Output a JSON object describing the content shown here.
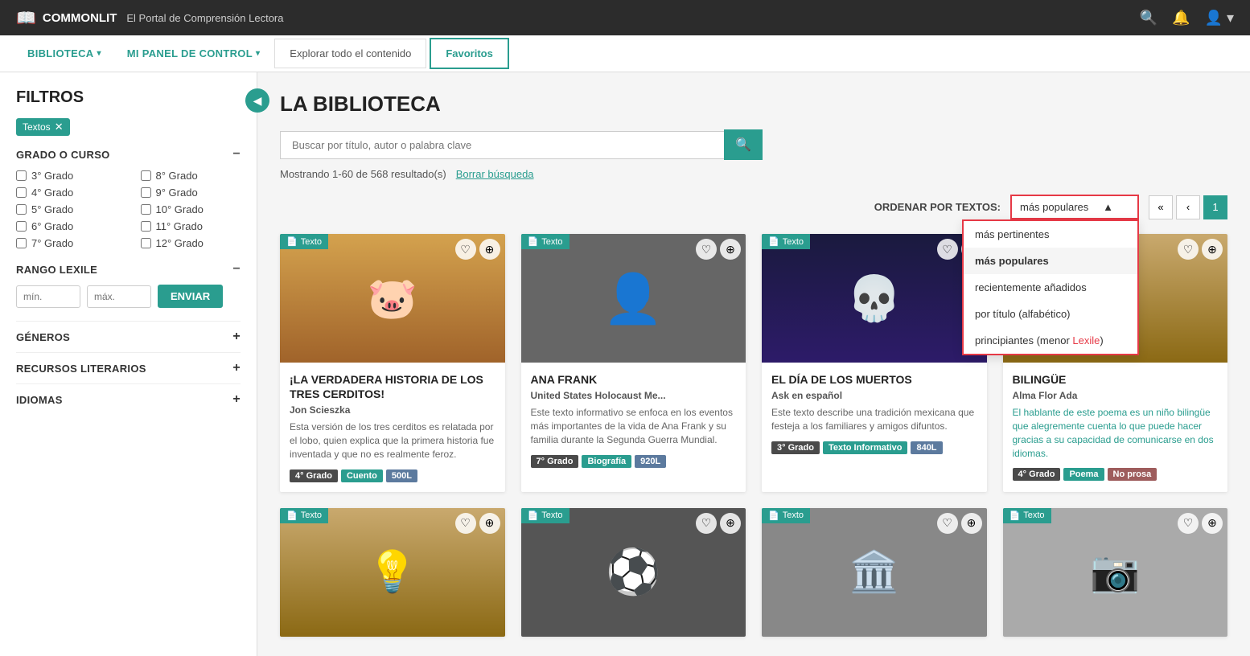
{
  "brand": {
    "name": "COMMONLIT",
    "tagline": "El Portal de Comprensión Lectora"
  },
  "topnav": {
    "icons": [
      "search",
      "bell",
      "user"
    ]
  },
  "secondarynav": {
    "items": [
      {
        "id": "biblioteca",
        "label": "BIBLIOTECA",
        "hasCaret": true
      },
      {
        "id": "mi-panel",
        "label": "MI PANEL DE CONTROL",
        "hasCaret": true
      }
    ],
    "tabs": [
      {
        "id": "explorar",
        "label": "Explorar todo el contenido",
        "active": false
      },
      {
        "id": "favoritos",
        "label": "Favoritos",
        "active": true
      }
    ]
  },
  "sidebar": {
    "title": "FILTROS",
    "activeFilter": "Textos",
    "sections": {
      "gradeTitle": "GRADO O CURSO",
      "gradesLeft": [
        "3° Grado",
        "4° Grado",
        "5° Grado",
        "6° Grado",
        "7° Grado"
      ],
      "gradesRight": [
        "8° Grado",
        "9° Grado",
        "10° Grado",
        "11° Grado",
        "12° Grado"
      ],
      "lexileTitle": "RANGO LEXILE",
      "lexileMin": "mín.",
      "lexileMax": "máx.",
      "enviarLabel": "ENVIAR",
      "genresTitle": "GÉNEROS",
      "literaryTitle": "RECURSOS LITERARIOS",
      "idiomasTitle": "IDIOMAS"
    }
  },
  "main": {
    "pageTitle": "LA BIBLIOTECA",
    "searchPlaceholder": "Buscar por título, autor o palabra clave",
    "resultsText": "Mostrando 1-60 de 568 resultado(s)",
    "clearText": "Borrar búsqueda",
    "sortLabel": "ORDENAR POR TEXTOS:",
    "sortSelected": "más populares",
    "sortOptions": [
      {
        "id": "relevantes",
        "label": "más pertinentes"
      },
      {
        "id": "populares",
        "label": "más populares",
        "selected": true
      },
      {
        "id": "recientes",
        "label": "recientemente añadidos"
      },
      {
        "id": "titulo",
        "label": "por título (alfabético)"
      },
      {
        "id": "principiantes",
        "label": "principiantes (menor Lexile)",
        "highlightWord": "Lexile"
      }
    ],
    "pagination": {
      "prev2": "«",
      "prev": "‹",
      "current": "1"
    },
    "cards": [
      {
        "id": "tres-cerditos",
        "labelIcon": "📄",
        "labelText": "Texto",
        "bgColor": "#8B6914",
        "emoji": "🐷",
        "title": "¡LA VERDADERA HISTORIA DE LOS TRES CERDITOS!",
        "author": "Jon Scieszka",
        "desc": "Esta versión de los tres cerditos es relatada por el lobo, quien explica que la primera historia fue inventada y que no es realmente feroz.",
        "tags": [
          {
            "label": "4° Grado",
            "type": "grade"
          },
          {
            "label": "Cuento",
            "type": "genre"
          },
          {
            "label": "500L",
            "type": "lexile"
          }
        ]
      },
      {
        "id": "ana-frank",
        "labelIcon": "📄",
        "labelText": "Texto",
        "bgColor": "#555",
        "emoji": "📖",
        "title": "ANA FRANK",
        "author": "United States Holocaust Me...",
        "desc": "Este texto informativo se enfoca en los eventos más importantes de la vida de Ana Frank y su familia durante la Segunda Guerra Mundial.",
        "tags": [
          {
            "label": "7° Grado",
            "type": "grade"
          },
          {
            "label": "Biografía",
            "type": "genre"
          },
          {
            "label": "920L",
            "type": "lexile"
          }
        ]
      },
      {
        "id": "dia-muertos",
        "labelIcon": "📄",
        "labelText": "Texto",
        "bgColor": "#1a1a3e",
        "emoji": "💀",
        "title": "EL DÍA DE LOS MUERTOS",
        "author": "Ask en español",
        "desc": "Este texto describe una tradición mexicana que festeja a los familiares y amigos difuntos.",
        "tags": [
          {
            "label": "3° Grado",
            "type": "grade"
          },
          {
            "label": "Texto Informativo",
            "type": "genre"
          },
          {
            "label": "840L",
            "type": "lexile"
          }
        ]
      },
      {
        "id": "bilingue",
        "labelIcon": "📄",
        "labelText": "Texto",
        "bgColor": "#b8860b",
        "emoji": "📚",
        "title": "BILINGÜE",
        "author": "Alma Flor Ada",
        "descTeal": "El hablante de este poema es un niño bilingüe que alegremente cuenta lo que puede hacer gracias a su capacidad de comunicarse en dos idiomas.",
        "tags": [
          {
            "label": "4° Grado",
            "type": "grade"
          },
          {
            "label": "Poema",
            "type": "poem"
          },
          {
            "label": "No prosa",
            "type": "noprose"
          }
        ]
      }
    ],
    "bottomCards": [
      {
        "id": "bottom1",
        "labelText": "Texto",
        "bgColor": "#c9a96e",
        "emoji": "💡"
      },
      {
        "id": "bottom2",
        "labelText": "Texto",
        "bgColor": "#555",
        "emoji": "⚽"
      },
      {
        "id": "bottom3",
        "labelText": "Texto",
        "bgColor": "#777",
        "emoji": "🏛️"
      },
      {
        "id": "bottom4",
        "labelText": "Texto",
        "bgColor": "#888",
        "emoji": "📷"
      }
    ]
  }
}
